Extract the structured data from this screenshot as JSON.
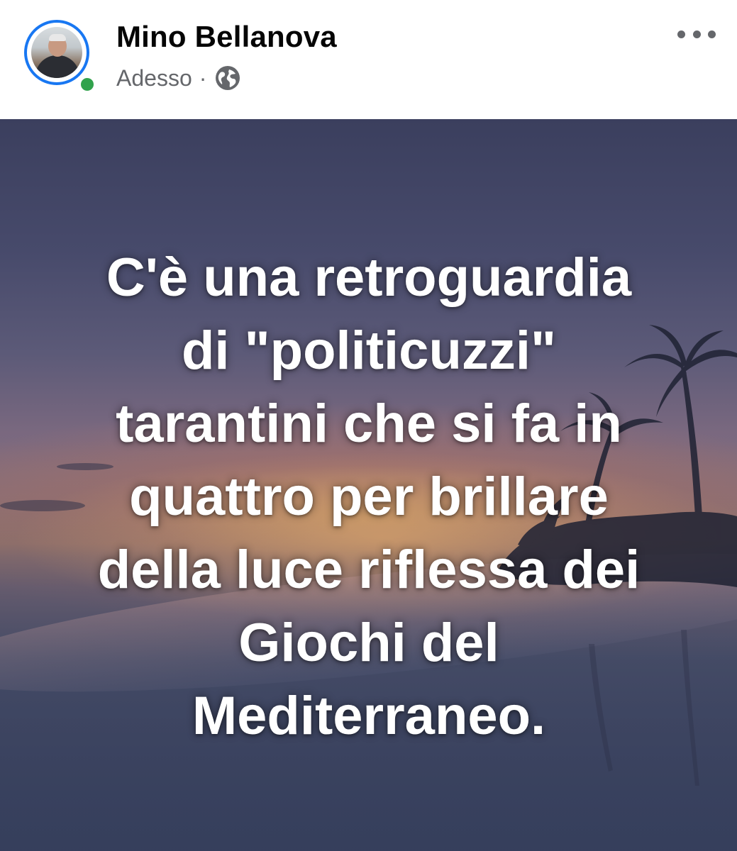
{
  "post": {
    "author_name": "Mino Bellanova",
    "timestamp": "Adesso",
    "separator": "·",
    "audience_icon": "globe-icon",
    "options_icon": "more-options-icon",
    "online_status_color": "#31a24c",
    "story_ring_color": "#1877f2"
  },
  "image": {
    "quote_lines": [
      "C'è una retroguardia",
      "di \"politicuzzi\"",
      "tarantini che si fa in",
      "quattro per brillare",
      "della luce riflessa dei",
      "Giochi del",
      "Mediterraneo."
    ]
  }
}
